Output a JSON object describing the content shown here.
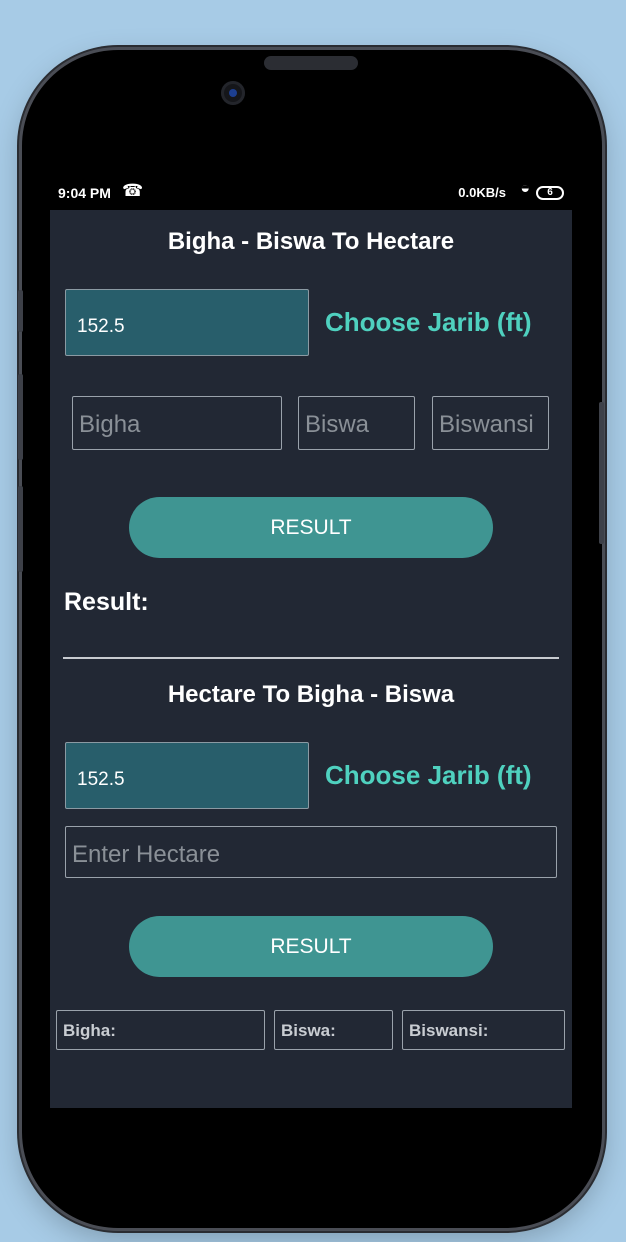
{
  "status_bar": {
    "time": "9:04 PM",
    "call_icon": "wifi-call-icon",
    "network_speed": "0.0KB/s",
    "battery_level": "6"
  },
  "section1": {
    "title": "Bigha - Biswa To Hectare",
    "jarib_value": "152.5",
    "choose_jarib_label": "Choose Jarib (ft)",
    "bigha_placeholder": "Bigha",
    "biswa_placeholder": "Biswa",
    "biswansi_placeholder": "Biswansi",
    "result_button": "RESULT",
    "result_label": "Result:"
  },
  "section2": {
    "title": "Hectare To Bigha - Biswa",
    "jarib_value": "152.5",
    "choose_jarib_label": "Choose Jarib (ft)",
    "hectare_placeholder": "Enter Hectare",
    "result_button": "RESULT",
    "bigha_output": "Bigha:",
    "biswa_output": "Biswa:",
    "biswansi_output": "Biswansi:"
  },
  "colors": {
    "page_background": "#a7cbe6",
    "screen_background": "#222834",
    "accent": "#4fd1bf",
    "button": "#3f9592",
    "input_fill": "#285e6b"
  }
}
